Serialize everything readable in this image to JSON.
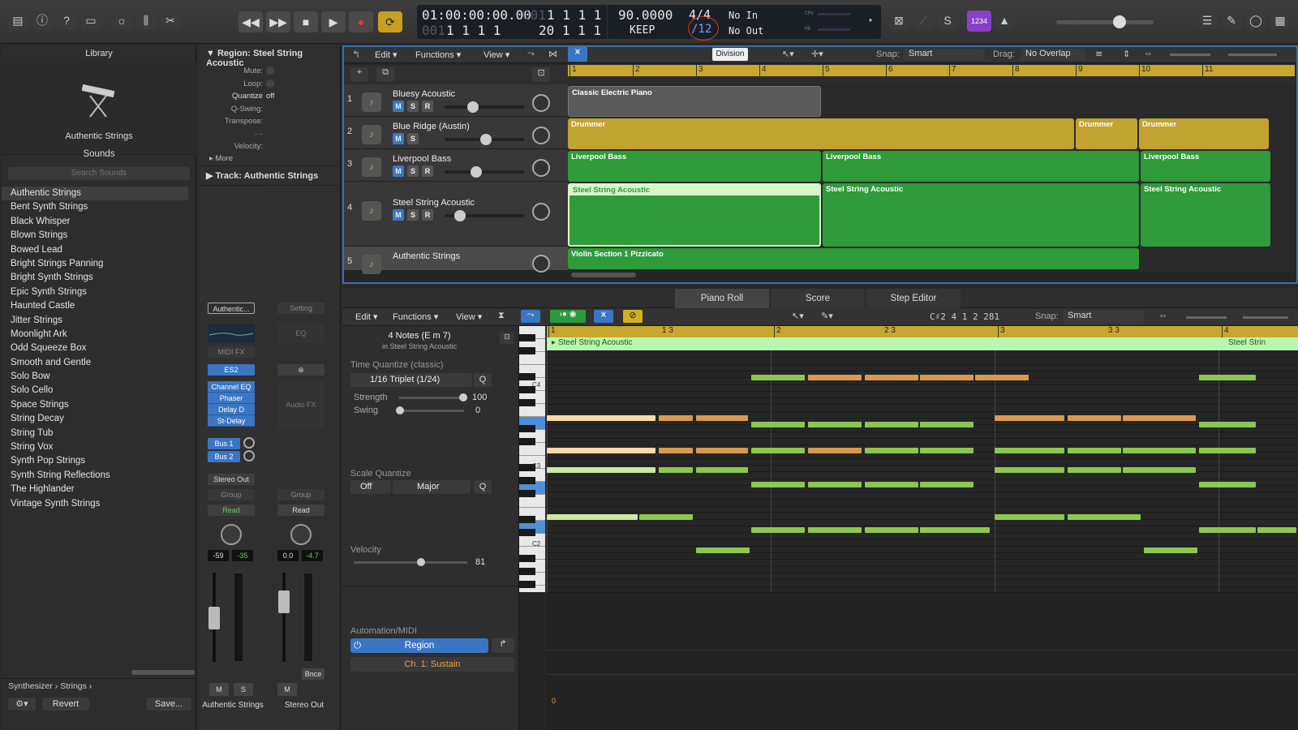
{
  "toolbar": {
    "transport": {
      "rewind": "◀◀",
      "forward": "▶▶",
      "stop": "■",
      "play": "▶",
      "record": "●",
      "cycle": "⟳"
    },
    "lcd": {
      "time": "01:00:00:00.00",
      "bars": "1  1  1  1",
      "tempo": "90.0000",
      "tempo_mode": "KEEP",
      "sig": "4/4",
      "division": "/12",
      "in": "No In",
      "out": "No Out",
      "pos2": "1  1  1  1",
      "pos3": "20  1  1  1",
      "pos_dim1": "001",
      "pos_dim2": "001",
      "cpu": "CPU",
      "hd": "HD"
    },
    "division_tooltip": "Division",
    "count_in": "1234"
  },
  "library": {
    "title": "Library",
    "patch_name": "Authentic Strings",
    "sounds_label": "Sounds",
    "search_placeholder": "Search Sounds",
    "items": [
      "Authentic Strings",
      "Bent Synth Strings",
      "Black Whisper",
      "Blown Strings",
      "Bowed Lead",
      "Bright Strings Panning",
      "Bright Synth Strings",
      "Epic Synth Strings",
      "Haunted Castle",
      "Jitter Strings",
      "Moonlight Ark",
      "Odd Squeeze Box",
      "Smooth and Gentle",
      "Solo Bow",
      "Solo Cello",
      "Space Strings",
      "String Decay",
      "String Tub",
      "String Vox",
      "Synth Pop Strings",
      "Synth String Reflections",
      "The Highlander",
      "Vintage Synth Strings"
    ],
    "breadcrumb": "Synthesizer  ›  Strings  ›",
    "revert": "Revert",
    "save": "Save..."
  },
  "inspector": {
    "region_title": "Region: Steel String Acoustic",
    "mute": "Mute:",
    "loop": "Loop:",
    "quantize": "Quantize",
    "quantize_val": "off",
    "qswing": "Q-Swing:",
    "transpose": "Transpose:",
    "velocity": "Velocity:",
    "more": "More",
    "velocity_val": "- -",
    "track_title": "Track:  Authentic Strings",
    "strip1": {
      "setting": "Authentic...",
      "midifx": "MIDI FX",
      "instrument": "ES2",
      "fx": [
        "Channel EQ",
        "Phaser",
        "Delay D",
        "St-Delay"
      ],
      "bus1": "Bus 1",
      "bus2": "Bus 2",
      "output": "Stereo Out",
      "group": "Group",
      "auto": "Read",
      "vol": "-59",
      "peak": "-35",
      "name": "Authentic Strings",
      "m": "M",
      "s": "S"
    },
    "strip2": {
      "setting": "Setting",
      "eq": "EQ",
      "audiofx": "Audio FX",
      "group": "Group",
      "auto": "Read",
      "vol": "0.0",
      "peak": "-4.7",
      "name": "Stereo Out",
      "m": "M",
      "bnce": "Bnce"
    }
  },
  "tracks": {
    "menu": {
      "edit": "Edit",
      "functions": "Functions",
      "view": "View"
    },
    "snap_label": "Snap:",
    "snap_val": "Smart",
    "drag_label": "Drag:",
    "drag_val": "No Overlap",
    "ruler": [
      "1",
      "2",
      "3",
      "4",
      "5",
      "6",
      "7",
      "8",
      "9",
      "10",
      "11"
    ],
    "list": [
      {
        "num": "1",
        "name": "Bluesy Acoustic"
      },
      {
        "num": "2",
        "name": "Blue Ridge (Austin)"
      },
      {
        "num": "3",
        "name": "Liverpool Bass"
      },
      {
        "num": "4",
        "name": "Steel String Acoustic"
      },
      {
        "num": "5",
        "name": "Authentic Strings"
      }
    ],
    "regions": {
      "piano": "Classic Electric Piano",
      "drummer": "Drummer",
      "bass": "Liverpool Bass",
      "steel": "Steel String Acoustic",
      "violin": "Violin Section 1 Pizzicato"
    },
    "msr": {
      "m": "M",
      "s": "S",
      "r": "R"
    }
  },
  "pianoroll": {
    "tabs": [
      "Piano Roll",
      "Score",
      "Step Editor"
    ],
    "menu": {
      "edit": "Edit",
      "functions": "Functions",
      "view": "View"
    },
    "position": "C♯2   4 1 2 281",
    "snap_label": "Snap:",
    "snap_val": "Smart",
    "notes_title": "4 Notes (E m 7)",
    "notes_sub": "in Steel String Acoustic",
    "tq_label": "Time Quantize (classic)",
    "tq_val": "1/16 Triplet (1/24)",
    "q": "Q",
    "strength_label": "Strength",
    "strength_val": "100",
    "swing_label": "Swing",
    "swing_val": "0",
    "scale_label": "Scale Quantize",
    "scale_off": "Off",
    "scale_mode": "Major",
    "velocity_label": "Velocity",
    "velocity_val": "81",
    "automation_label": "Automation/MIDI",
    "region_btn": "Region",
    "sustain": "Ch. 1: Sustain",
    "ruler": [
      "1",
      "1 3",
      "2",
      "2 3",
      "3",
      "3 3",
      "4"
    ],
    "region_name": "Steel String Acoustic",
    "region_name2": "Steel Strin",
    "keys": [
      "C4",
      "C3",
      "C2"
    ],
    "auto_zero": "0"
  },
  "colors": {
    "green": "#2f9b3a",
    "yellow": "#b89a2a",
    "accent": "#3b6fb0"
  }
}
